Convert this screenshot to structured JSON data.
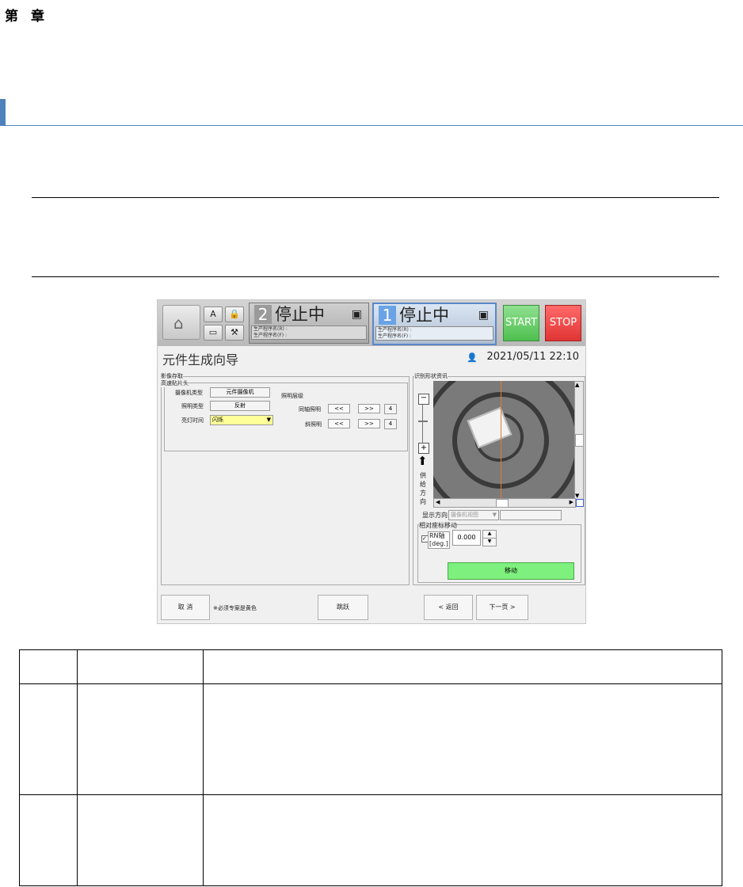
{
  "chapter": {
    "first": "第",
    "second": "章"
  },
  "shot": {
    "panel2": {
      "num": "2",
      "status": "停止中",
      "line1": "生产程序名(R) :",
      "line2": "生产程序名(F) :"
    },
    "panel1": {
      "num": "1",
      "status": "停止中",
      "line1": "生产程序名(R) :",
      "line2": "生产程序名(F) :"
    },
    "start_label": "START",
    "stop_label": "STOP",
    "window_title": "元件生成向导",
    "datetime": "2021/05/11 22:10",
    "image_capture": {
      "group_title": "影像存取",
      "head_title": "高速贴片头",
      "camera_type_label": "摄像机类型",
      "camera_type_value": "元件摄像机",
      "light_type_label": "照明类型",
      "light_type_value": "反射",
      "on_time_label": "亮灯时间",
      "on_time_value": "闪烁",
      "light_level_label": "照明层级",
      "coaxial_label": "同轴照明",
      "oblique_label": "斜照明",
      "dec_label": "<<",
      "inc_label": ">>",
      "coaxial_value": "4",
      "oblique_value": "4"
    },
    "recognition": {
      "title": "识别形状资讯",
      "feed_direction": [
        "供",
        "给",
        "方",
        "向"
      ],
      "display_direction_label": "显示方向",
      "display_direction_value": "摄像机视图",
      "relative_move_title": "相对座标移动",
      "rn_axis_label_1": "RN轴",
      "rn_axis_label_2": "[deg.]",
      "rn_value": "0.000",
      "move_label": "移动"
    },
    "footer": {
      "cancel_label": "取 消",
      "required_note": "※必须专案是黄色",
      "skip_label": "跳跃",
      "back_label": "< 返回",
      "next_label": "下一页 >"
    },
    "colors": {
      "start": "#5bc85b",
      "stop": "#e63b3b",
      "move": "#7df07d",
      "required": "#ffff99"
    }
  }
}
